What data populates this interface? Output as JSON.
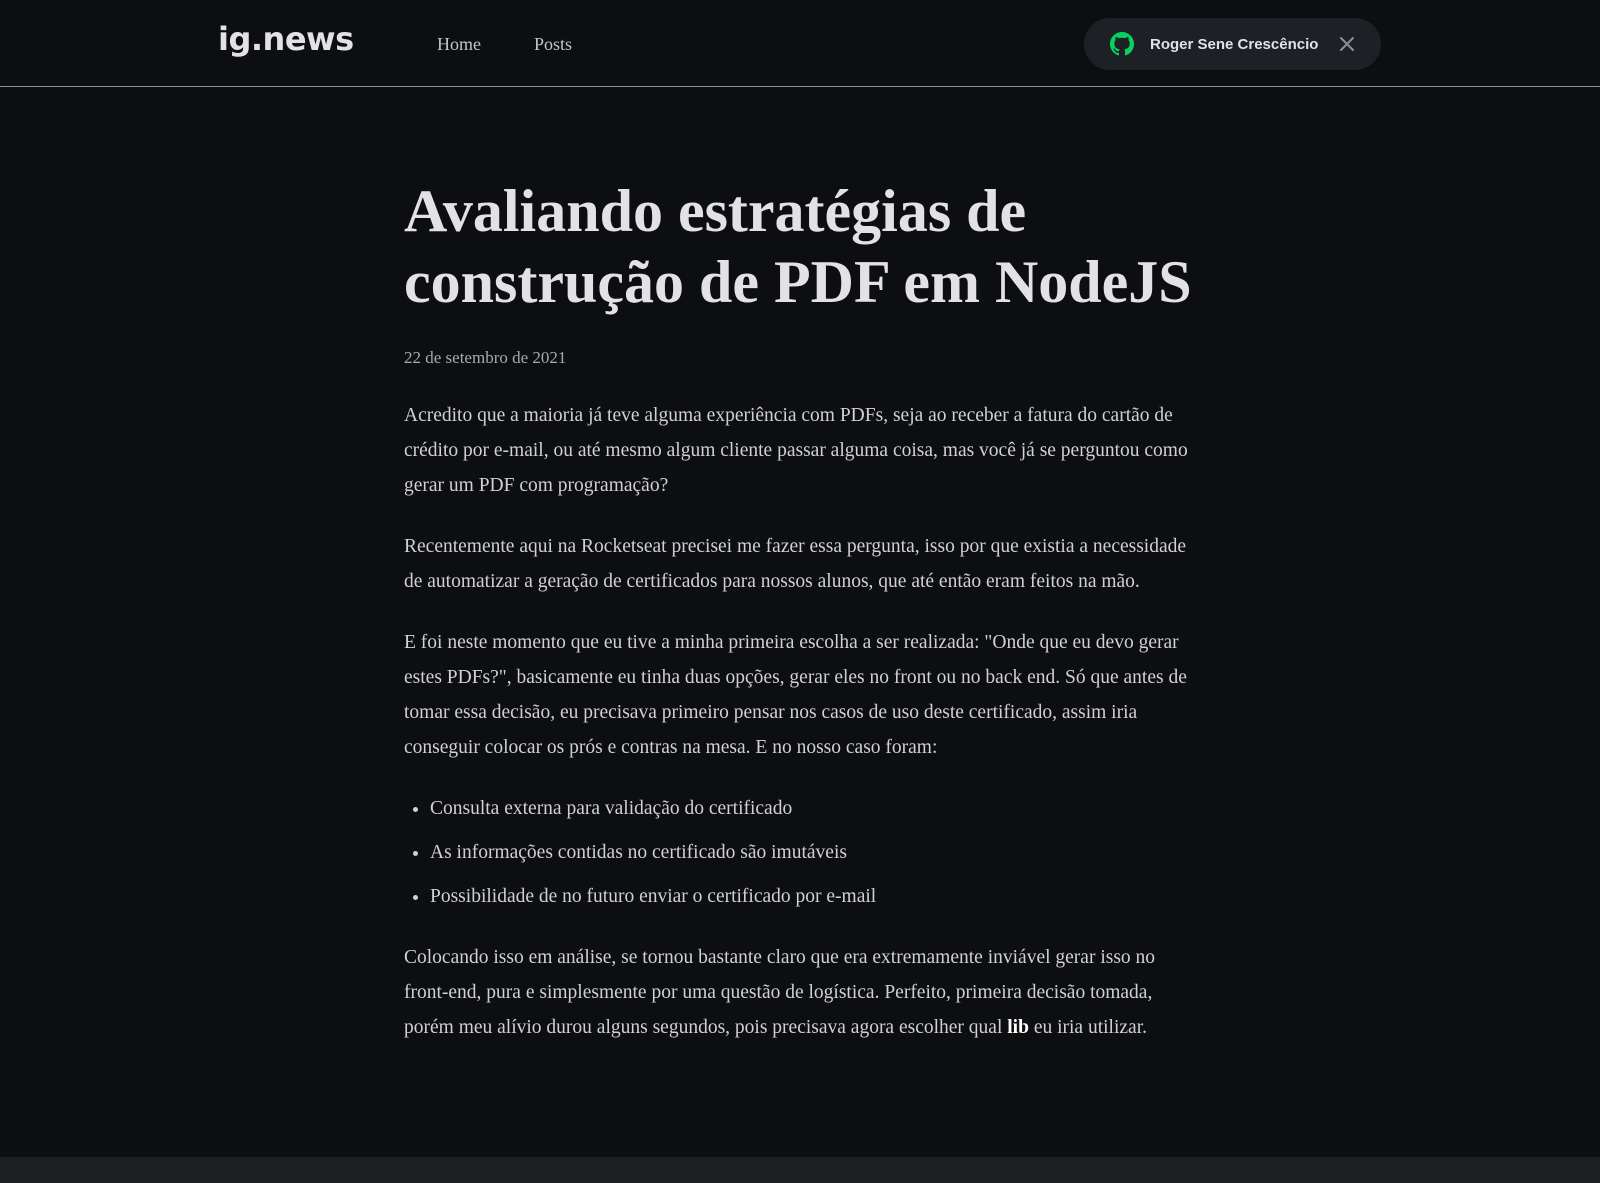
{
  "header": {
    "logo": "ig.news",
    "nav": [
      {
        "label": "Home"
      },
      {
        "label": "Posts"
      }
    ],
    "user": {
      "name": "Roger Sene Crescêncio",
      "icon": "github-icon",
      "close_icon": "close-icon",
      "icon_color": "#04d361"
    }
  },
  "post": {
    "title": "Avaliando estratégias de construção de PDF em NodeJS",
    "date": "22 de setembro de 2021",
    "paragraphs": [
      "Acredito que a maioria já teve alguma experiência com PDFs, seja ao receber a fatura do cartão de crédito por e-mail, ou até mesmo algum cliente passar alguma coisa, mas você já se perguntou como gerar um PDF com programação?",
      "Recentemente aqui na Rocketseat precisei me fazer essa pergunta, isso por que  existia a necessidade de automatizar a geração de certificados para nossos alunos, que até então eram feitos na mão.",
      "E foi neste momento que eu tive a minha primeira escolha a ser realizada: \"Onde que eu devo gerar estes PDFs?\", basicamente eu tinha duas opções, gerar eles no front ou no back end. Só que antes de tomar essa decisão, eu precisava primeiro pensar nos casos de uso deste certificado, assim iria conseguir colocar os prós e contras na mesa. E no nosso caso foram:"
    ],
    "list": [
      "Consulta externa para validação do certificado",
      "As informações contidas no certificado são imutáveis",
      "Possibilidade de no futuro enviar o certificado por e-mail"
    ],
    "last_paragraph": {
      "before": "Colocando isso em análise, se tornou bastante claro que era extremamente inviável gerar isso no front-end, pura e simplesmente por uma questão de logística. Perfeito, primeira decisão tomada, porém meu alívio durou alguns segundos, pois precisava agora escolher qual ",
      "bold": "lib",
      "after": " eu iria utilizar."
    }
  }
}
